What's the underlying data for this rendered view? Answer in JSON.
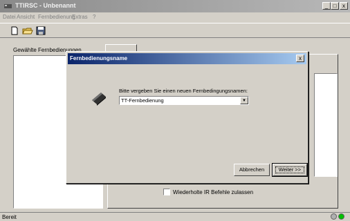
{
  "main_window": {
    "title": "TTIRSC - Unbenannt",
    "controls": {
      "minimize": "_",
      "maximize": "□",
      "close": "x"
    }
  },
  "menu": [
    "Datei",
    "Ansicht",
    "Fernbedienung",
    "Extras",
    "?"
  ],
  "toolbar": {
    "tools": [
      "new-icon",
      "open-folder-icon",
      "save-icon"
    ]
  },
  "workspace": {
    "selected_remotes_label": "Gewählte Fernbedienungen",
    "repeat_checkbox_label": "Wiederholte IR Befehle zulassen",
    "repeat_checked": false
  },
  "status_bar": {
    "text": "Bereit",
    "indicator_colors": [
      "#b0b0b0",
      "#00c000",
      "#d4d0c8"
    ]
  },
  "dialog": {
    "title": "Fernbedienungsname",
    "close": "x",
    "icon": "remote-control-icon",
    "prompt": "Bitte vergeben Sie einen neuen Fernbedingungsnamen:",
    "name_value": "TT-Fernbedienung",
    "cancel_label": "Abbrechen",
    "next_label": "Weiter >>"
  },
  "colors": {
    "dialog_title_start": "#0a246a",
    "dialog_title_end": "#a6caf0",
    "window_face": "#d4d0c8"
  }
}
